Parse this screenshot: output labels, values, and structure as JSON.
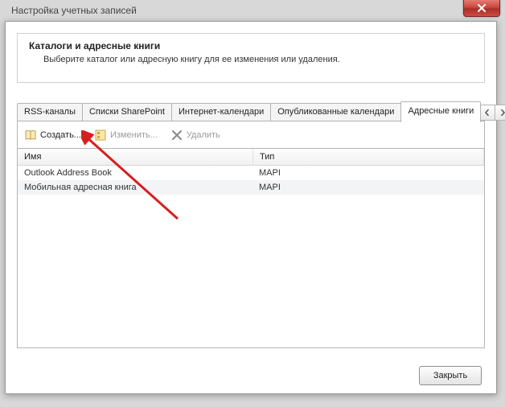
{
  "window": {
    "title": "Настройка учетных записей"
  },
  "header": {
    "heading": "Каталоги и адресные книги",
    "sub": "Выберите каталог или адресную книгу для ее изменения или удаления."
  },
  "tabs": {
    "items": [
      {
        "label": "RSS-каналы"
      },
      {
        "label": "Списки SharePoint"
      },
      {
        "label": "Интернет-календари"
      },
      {
        "label": "Опубликованные календари"
      },
      {
        "label": "Адресные книги"
      }
    ]
  },
  "toolbar": {
    "create": "Создать...",
    "edit": "Изменить...",
    "del": "Удалить"
  },
  "columns": {
    "name": "Имя",
    "type": "Тип"
  },
  "rows": [
    {
      "name": "Outlook Address Book",
      "type": "MAPI"
    },
    {
      "name": "Мобильная адресная книга",
      "type": "MAPI"
    }
  ],
  "footer": {
    "close": "Закрыть"
  }
}
